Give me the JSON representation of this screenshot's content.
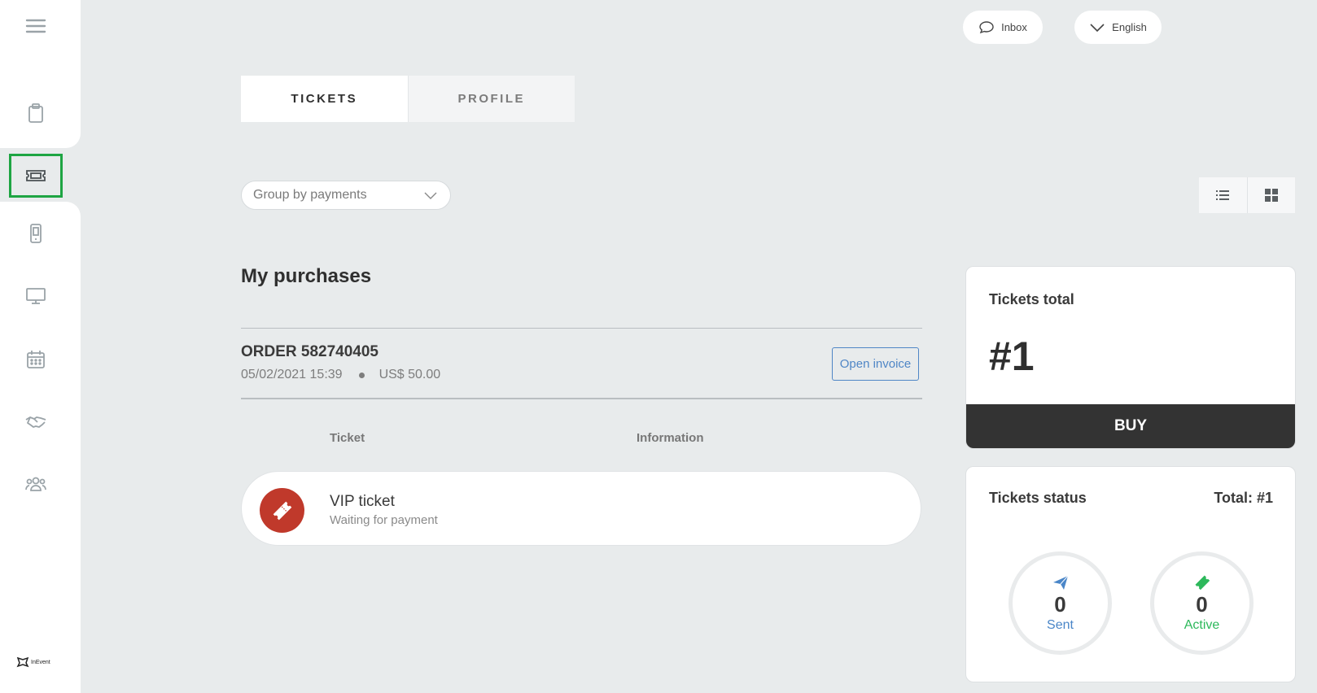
{
  "header": {
    "inbox_label": "Inbox",
    "language_label": "English"
  },
  "tabs": [
    {
      "label": "TICKETS",
      "active": true
    },
    {
      "label": "PROFILE",
      "active": false
    }
  ],
  "filter": {
    "group_by": "Group by payments"
  },
  "purchases": {
    "title": "My purchases",
    "order": {
      "title": "ORDER 582740405",
      "date": "05/02/2021 15:39",
      "amount": "US$ 50.00",
      "invoice_label": "Open invoice"
    },
    "columns": {
      "ticket": "Ticket",
      "information": "Information"
    },
    "ticket": {
      "name": "VIP ticket",
      "status": "Waiting for payment"
    }
  },
  "tickets_total": {
    "label": "Tickets total",
    "value": "#1",
    "buy_label": "BUY"
  },
  "tickets_status": {
    "label": "Tickets status",
    "total": "Total: #1",
    "sent": {
      "count": "0",
      "label": "Sent"
    },
    "active": {
      "count": "0",
      "label": "Active"
    }
  },
  "brand": {
    "logo_text": "InEvent"
  },
  "colors": {
    "active_nav_border": "#1ea543",
    "ticket_icon_bg": "#c0392b",
    "sent": "#4a86c8",
    "active": "#2db85b",
    "invoice": "#4f86c6"
  }
}
